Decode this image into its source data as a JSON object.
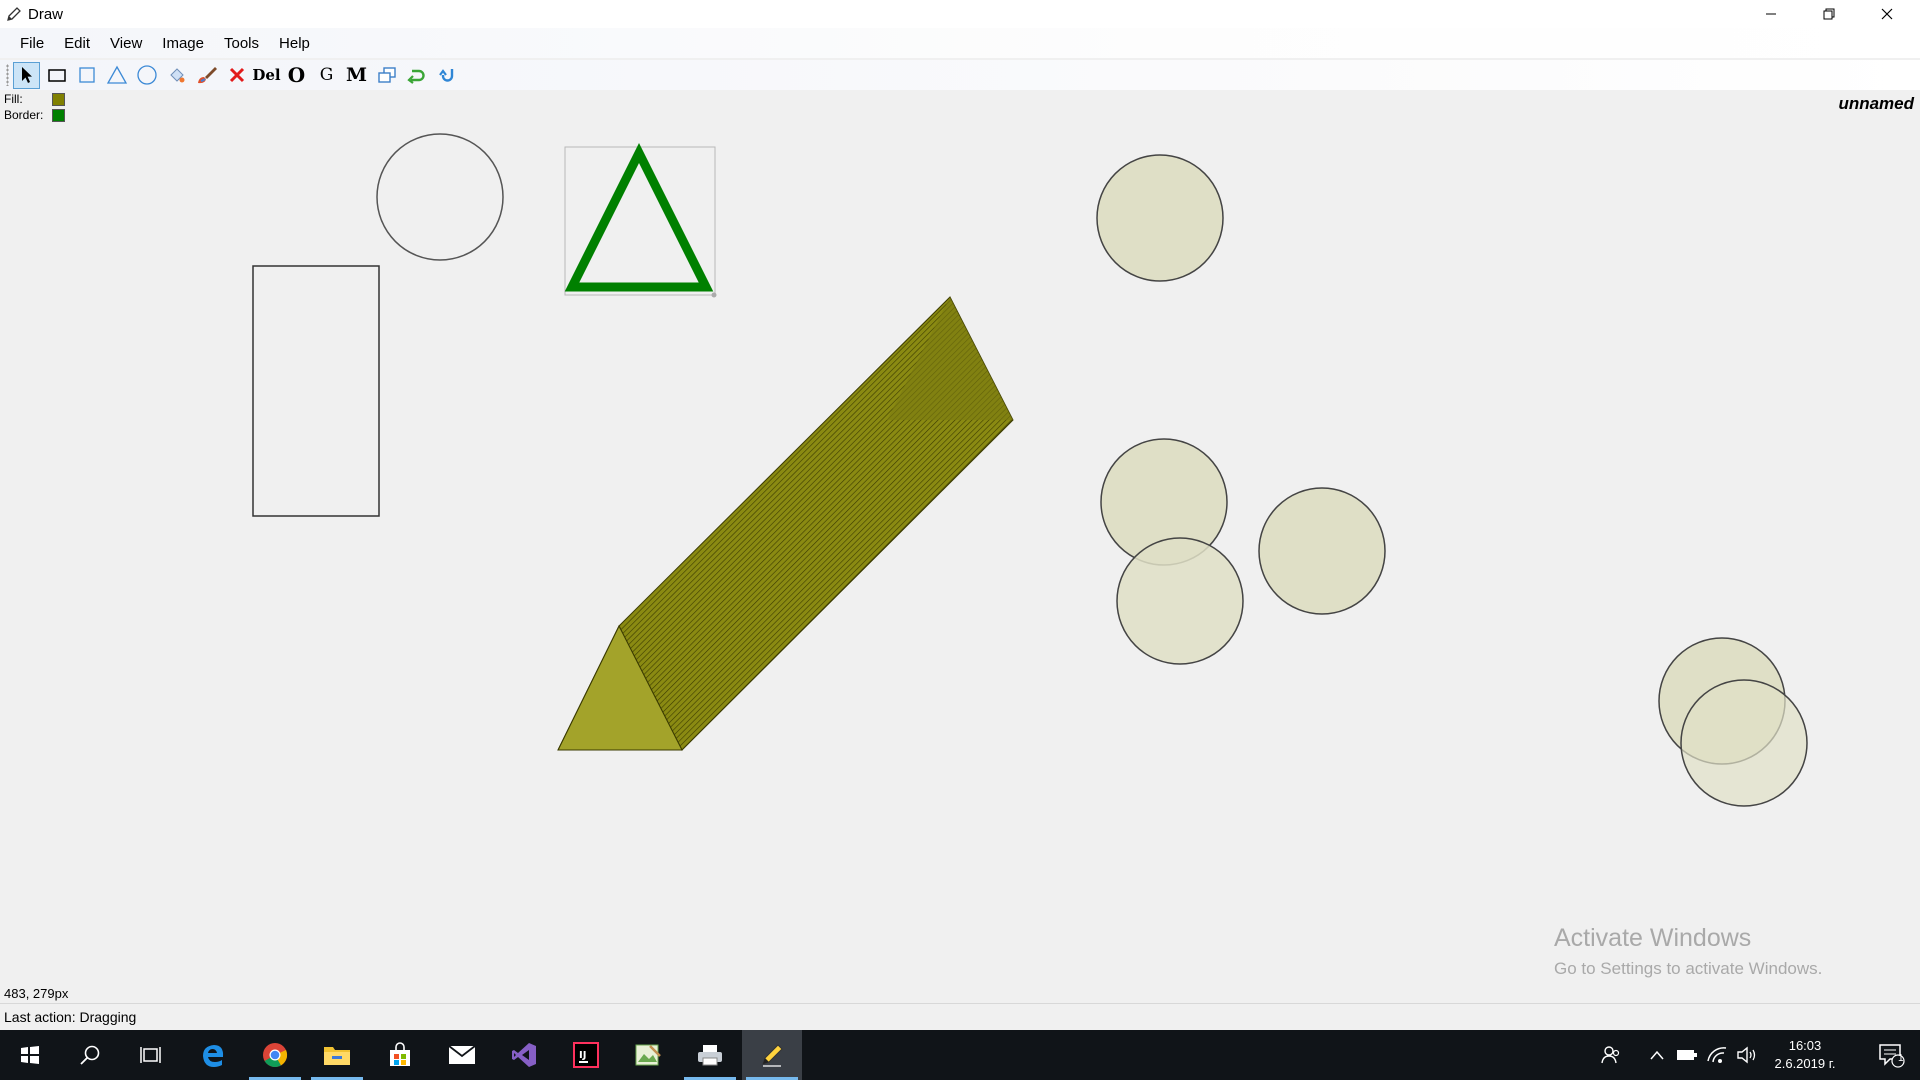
{
  "window": {
    "title": "Draw",
    "icons": {
      "app": "pencil-icon",
      "minimize": "minimize-icon",
      "maximize": "restore-icon",
      "close": "close-icon"
    }
  },
  "menu": [
    "File",
    "Edit",
    "View",
    "Image",
    "Tools",
    "Help"
  ],
  "toolbar": [
    {
      "name": "select-tool",
      "icon": "arrow-cursor-icon",
      "active": true
    },
    {
      "name": "rectangle-tool",
      "icon": "rectangle-icon"
    },
    {
      "name": "square-tool",
      "icon": "square-icon"
    },
    {
      "name": "triangle-tool",
      "icon": "triangle-icon"
    },
    {
      "name": "ellipse-tool",
      "icon": "ellipse-icon"
    },
    {
      "name": "fill-color-tool",
      "icon": "paint-bucket-icon"
    },
    {
      "name": "border-color-tool",
      "icon": "brush-icon"
    },
    {
      "name": "delete-all-tool",
      "icon": "red-x-icon"
    },
    {
      "name": "delete-tool",
      "label": "Del"
    },
    {
      "name": "opacity-tool",
      "label": "O"
    },
    {
      "name": "group-tool",
      "label": "G"
    },
    {
      "name": "move-tool",
      "label": "M"
    },
    {
      "name": "copy-tool",
      "icon": "copy-icon"
    },
    {
      "name": "rotate-left-tool",
      "icon": "rotate-green-icon"
    },
    {
      "name": "undo-tool",
      "icon": "undo-blue-icon"
    }
  ],
  "swatches": {
    "fill_label": "Fill:",
    "fill_color": "#808000",
    "border_label": "Border:",
    "border_color": "#008000"
  },
  "document_name": "unnamed",
  "status": {
    "coords": "483, 279px",
    "last_action": "Last action: Dragging"
  },
  "watermark": {
    "title": "Activate Windows",
    "subtitle": "Go to Settings to activate Windows."
  },
  "taskbar": {
    "apps": [
      "windows-start-icon",
      "search-icon",
      "task-view-icon",
      "edge-icon",
      "chrome-icon",
      "file-explorer-icon",
      "store-icon",
      "mail-icon",
      "visual-studio-icon",
      "intellij-icon",
      "image-editor-icon",
      "printer-icon",
      "draw-app-icon"
    ],
    "tray": [
      "people-icon",
      "chevron-up-icon",
      "battery-icon",
      "wifi-icon",
      "volume-icon",
      "notifications-icon"
    ],
    "time": "16:03",
    "date": "2.6.2019 г.",
    "notification_count": "1"
  },
  "colors": {
    "shape_fill": "#dfdfc6",
    "triangle_border": "#008000",
    "prism": "#8c8c14"
  }
}
